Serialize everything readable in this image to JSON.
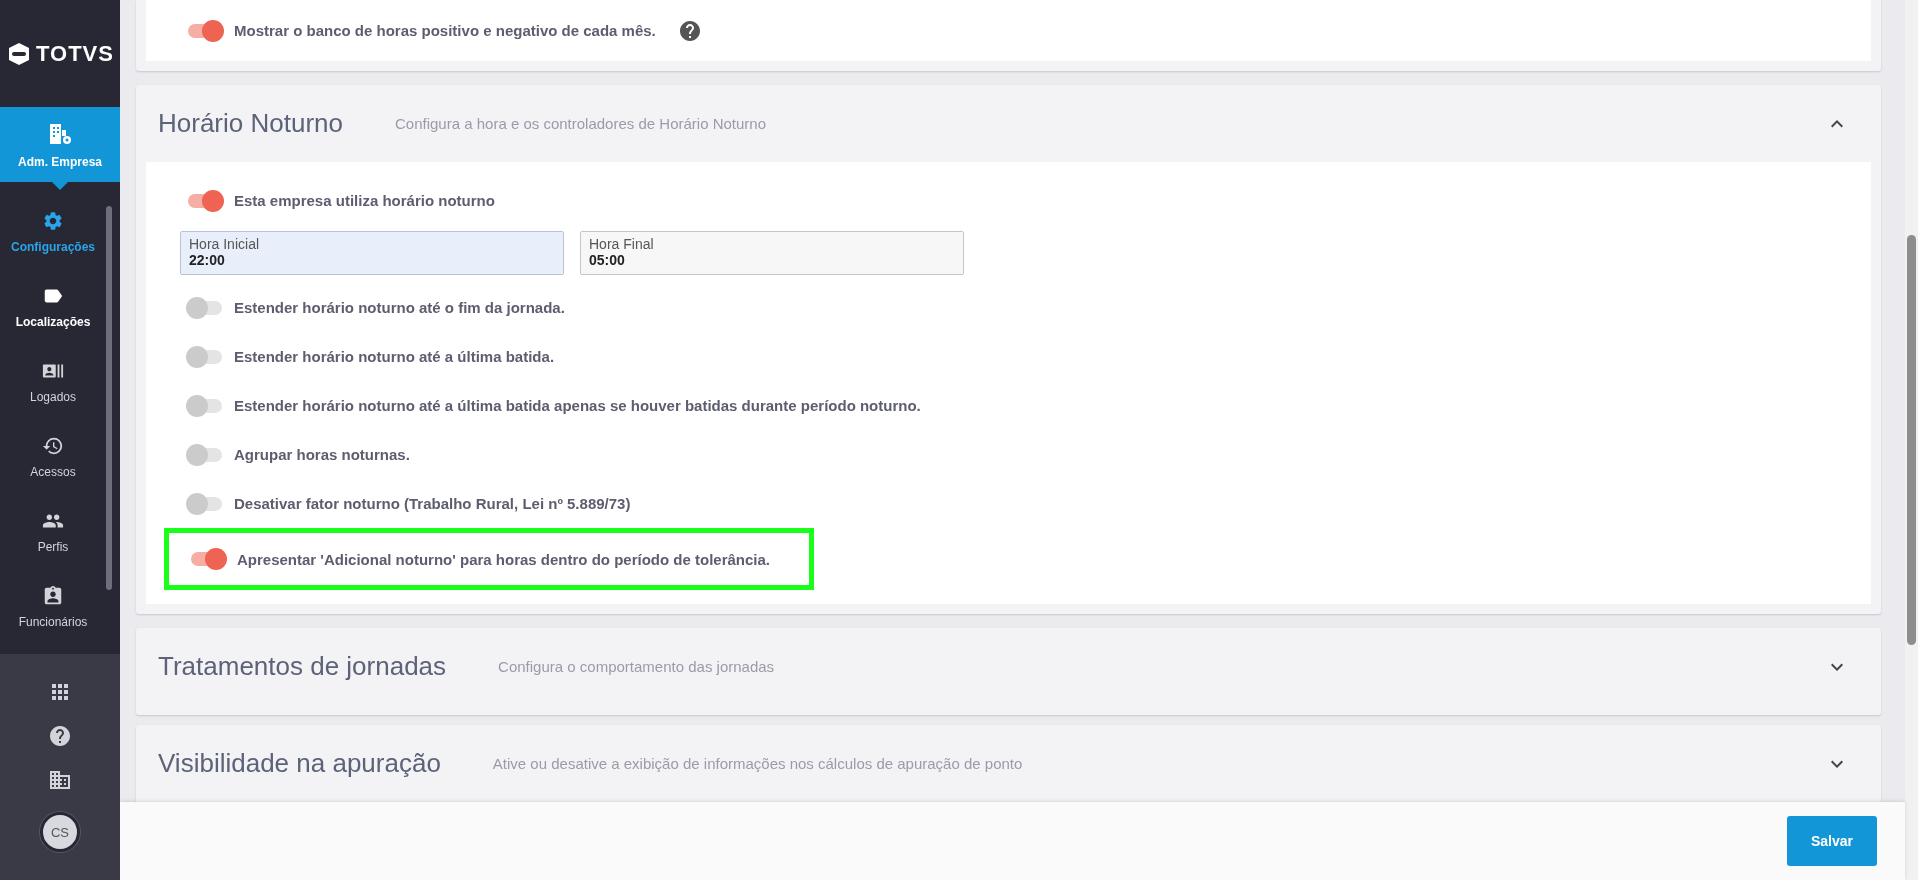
{
  "sidebar": {
    "logo": "TOTVS",
    "module": {
      "label": "Adm. Empresa"
    },
    "items": [
      {
        "kind": "settings",
        "label": "Configurações",
        "selected": true,
        "highlighted": false
      },
      {
        "kind": "tag",
        "label": "Localizações",
        "selected": false,
        "highlighted": true
      },
      {
        "kind": "contact",
        "label": "Logados",
        "selected": false,
        "highlighted": false
      },
      {
        "kind": "history",
        "label": "Acessos",
        "selected": false,
        "highlighted": false
      },
      {
        "kind": "people",
        "label": "Perfis",
        "selected": false,
        "highlighted": false
      },
      {
        "kind": "badge",
        "label": "Funcionários",
        "selected": false,
        "highlighted": false
      }
    ],
    "avatar": "CS"
  },
  "top_card": {
    "rows": [
      {
        "label": "Mostrar o banco de horas positivo e negativo de cada mês.",
        "on": true,
        "help": true
      }
    ]
  },
  "sections": [
    {
      "title": "Horário Noturno",
      "subtitle": "Configura a hora e os controladores de Horário Noturno",
      "expanded": true,
      "master": {
        "label": "Esta empresa utiliza horário noturno",
        "on": true
      },
      "fields": [
        {
          "label": "Hora Inicial",
          "value": "22:00",
          "focused": true
        },
        {
          "label": "Hora Final",
          "value": "05:00",
          "focused": false
        }
      ],
      "rows": [
        {
          "label": "Estender horário noturno até o fim da jornada.",
          "on": false
        },
        {
          "label": "Estender horário noturno até a última batida.",
          "on": false
        },
        {
          "label": "Estender horário noturno até a última batida apenas se houver batidas durante período noturno.",
          "on": false
        },
        {
          "label": "Agrupar horas noturnas.",
          "on": false
        },
        {
          "label": "Desativar fator noturno (Trabalho Rural, Lei nº 5.889/73)",
          "on": false
        },
        {
          "label": "Apresentar 'Adicional noturno' para horas dentro do período de tolerância.",
          "on": true,
          "highlighted": true
        }
      ]
    },
    {
      "title": "Tratamentos de jornadas",
      "subtitle": "Configura o comportamento das jornadas",
      "expanded": false
    },
    {
      "title": "Visibilidade na apuração",
      "subtitle": "Ative ou desative a exibição de informações nos cálculos de apuração de ponto",
      "expanded": false
    }
  ],
  "footer": {
    "save": "Salvar"
  }
}
